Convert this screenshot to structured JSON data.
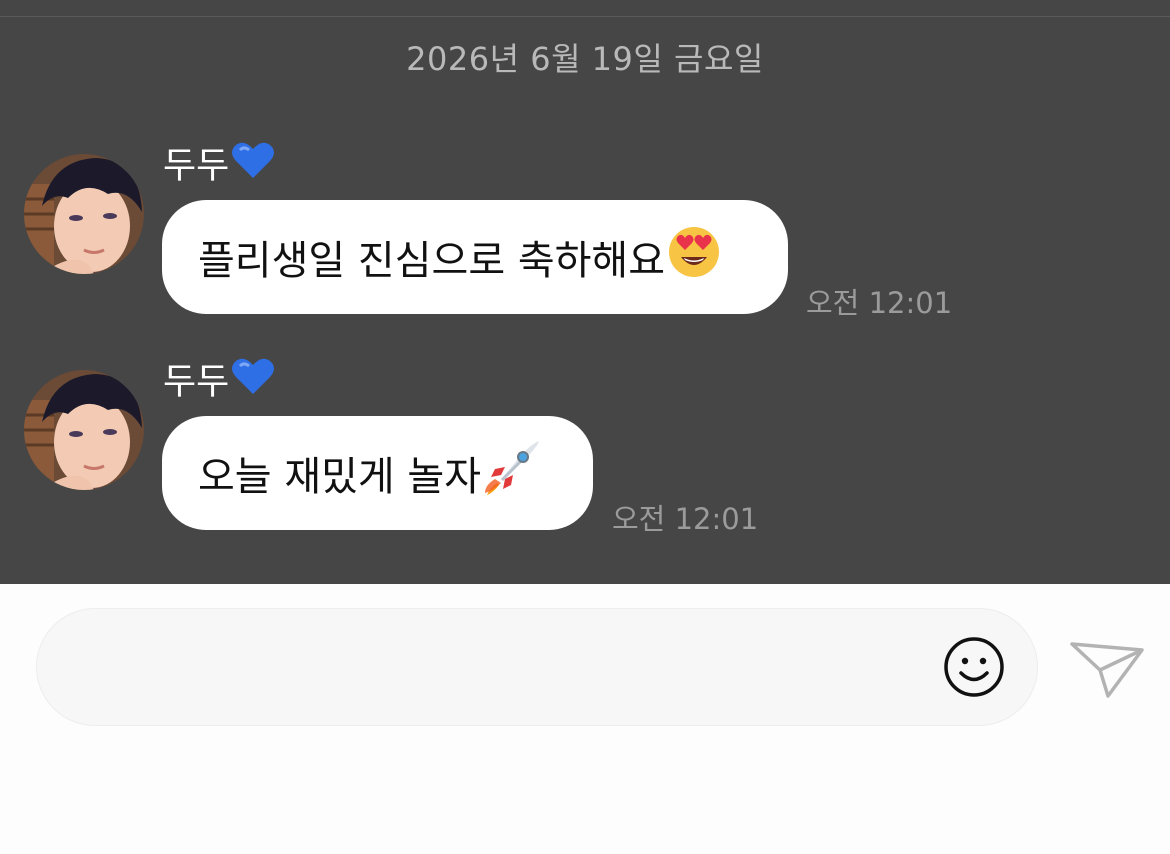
{
  "chat": {
    "date_divider": "2026년 6월 19일 금요일",
    "messages": [
      {
        "sender": "두두",
        "sender_emoji": "blue-heart",
        "text": "플리생일 진심으로 축하해요",
        "text_emoji": "heart-eyes-face",
        "time": "오전 12:01"
      },
      {
        "sender": "두두",
        "sender_emoji": "blue-heart",
        "text": "오늘 재밌게 놀자",
        "text_emoji": "rocket",
        "time": "오전 12:01"
      }
    ]
  },
  "composer": {
    "placeholder": "",
    "emoji_button_icon": "smiley-icon",
    "send_button_icon": "paper-plane-icon"
  },
  "colors": {
    "chat_background": "#464646",
    "bubble": "#ffffff",
    "heart": "#2f6fe6",
    "input_background": "#f7f7f7"
  }
}
